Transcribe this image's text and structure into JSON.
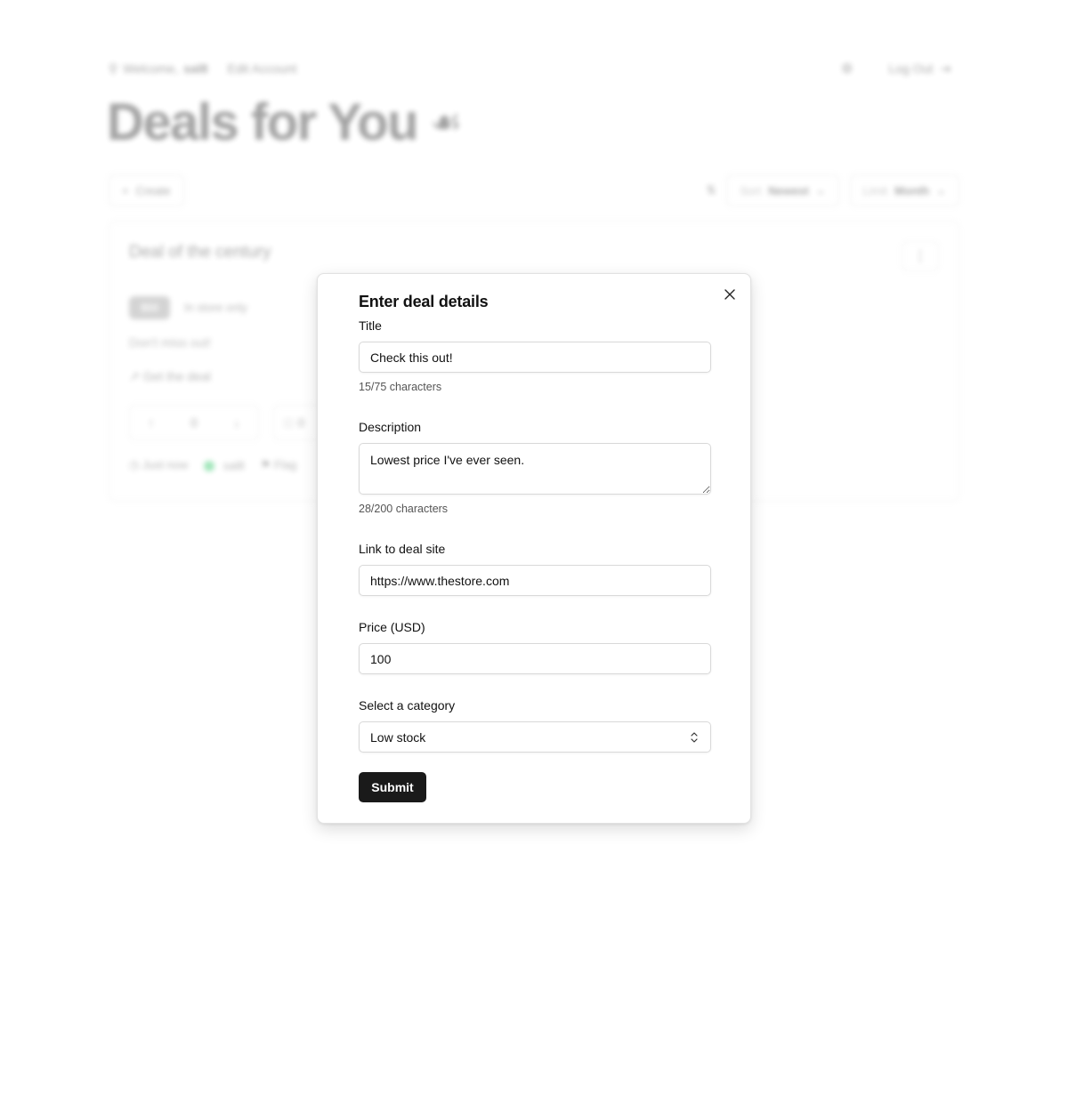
{
  "background": {
    "welcome_prefix": "Welcome,",
    "username": "sal8",
    "edit_account": "Edit Account",
    "logout": "Log Out",
    "page_title": "Deals for You",
    "create_label": "Create",
    "sort_label": "Sort",
    "sort_value": "Newest",
    "limit_label": "Limit",
    "limit_value": "Month",
    "card": {
      "title": "Deal of the century",
      "badge": "$50",
      "badge_note": "In store only",
      "description": "Don't miss out!",
      "link_text": "Get the deal",
      "vote_up": "↑",
      "vote_count": "0",
      "vote_down": "↓",
      "comments": "0",
      "time": "Just now",
      "author": "sal8",
      "flag": "Flag"
    }
  },
  "modal": {
    "title": "Enter deal details",
    "title_field": {
      "label": "Title",
      "value": "Check this out!",
      "counter": "15/75 characters"
    },
    "description_field": {
      "label": "Description",
      "value": "Lowest price I've ever seen.",
      "counter": "28/200 characters"
    },
    "link_field": {
      "label": "Link to deal site",
      "value": "https://www.thestore.com"
    },
    "price_field": {
      "label": "Price (USD)",
      "value": "100"
    },
    "category_field": {
      "label": "Select a category",
      "selected": "Low stock"
    },
    "submit_label": "Submit"
  },
  "icons": {
    "close": "close-icon",
    "select_chevron": "chevron-up-down-icon"
  }
}
